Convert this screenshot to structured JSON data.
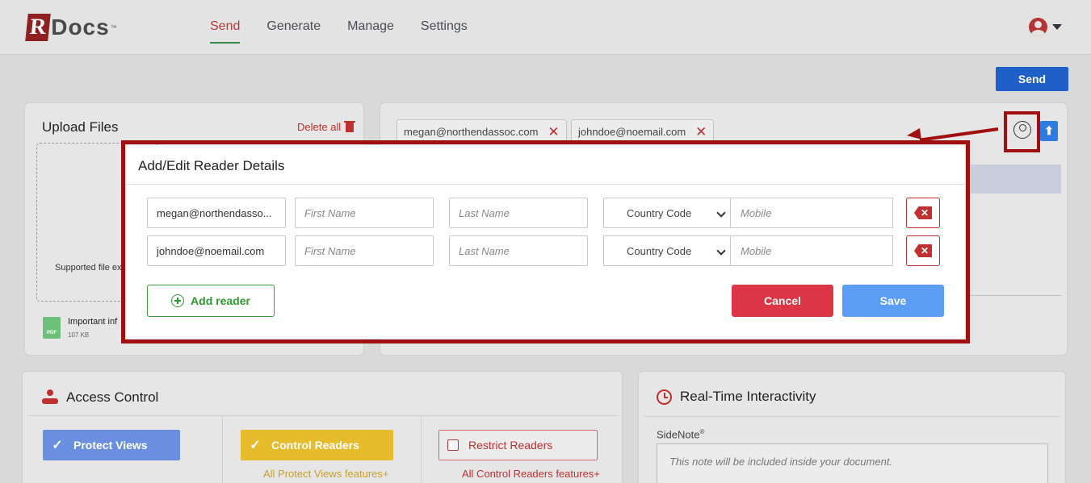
{
  "header": {
    "logo_letter": "R",
    "logo_text": "Docs",
    "logo_tm": "™",
    "nav": [
      "Send",
      "Generate",
      "Manage",
      "Settings"
    ],
    "active_nav": "Send"
  },
  "toolbar": {
    "send_label": "Send"
  },
  "upload": {
    "title": "Upload Files",
    "delete_all": "Delete all",
    "supported": "Supported file ex",
    "file_name": "Important inf",
    "file_size": "107 KB",
    "file_type": "PDF"
  },
  "readers": {
    "chips": [
      "megan@northendassoc.com",
      "johndoe@noemail.com"
    ],
    "upload_icon_glyph": "⬆"
  },
  "modal": {
    "title": "Add/Edit Reader Details",
    "rows": [
      {
        "email": "megan@northendasso...",
        "first_name_placeholder": "First Name",
        "last_name_placeholder": "Last Name",
        "country_code": "Country Code",
        "mobile_placeholder": "Mobile"
      },
      {
        "email": "johndoe@noemail.com",
        "first_name_placeholder": "First Name",
        "last_name_placeholder": "Last Name",
        "country_code": "Country Code",
        "mobile_placeholder": "Mobile"
      }
    ],
    "add_reader": "Add reader",
    "cancel": "Cancel",
    "save": "Save"
  },
  "access_control": {
    "title": "Access Control",
    "options": [
      {
        "label": "Protect Views",
        "checked": true
      },
      {
        "label": "Control Readers",
        "checked": true,
        "features": "All Protect Views features+"
      },
      {
        "label": "Restrict Readers",
        "checked": false,
        "features": "All Control Readers features+"
      }
    ]
  },
  "realtime": {
    "title": "Real-Time Interactivity",
    "sidenote_label": "SideNote",
    "sidenote_mark": "®",
    "sidenote_placeholder": "This note will be included inside your document."
  },
  "colors": {
    "brand_red": "#a01010",
    "primary_blue": "#1f5fc8",
    "cancel_red": "#dc3545",
    "save_blue": "#5b9cf5",
    "add_green": "#2e9a2e"
  }
}
